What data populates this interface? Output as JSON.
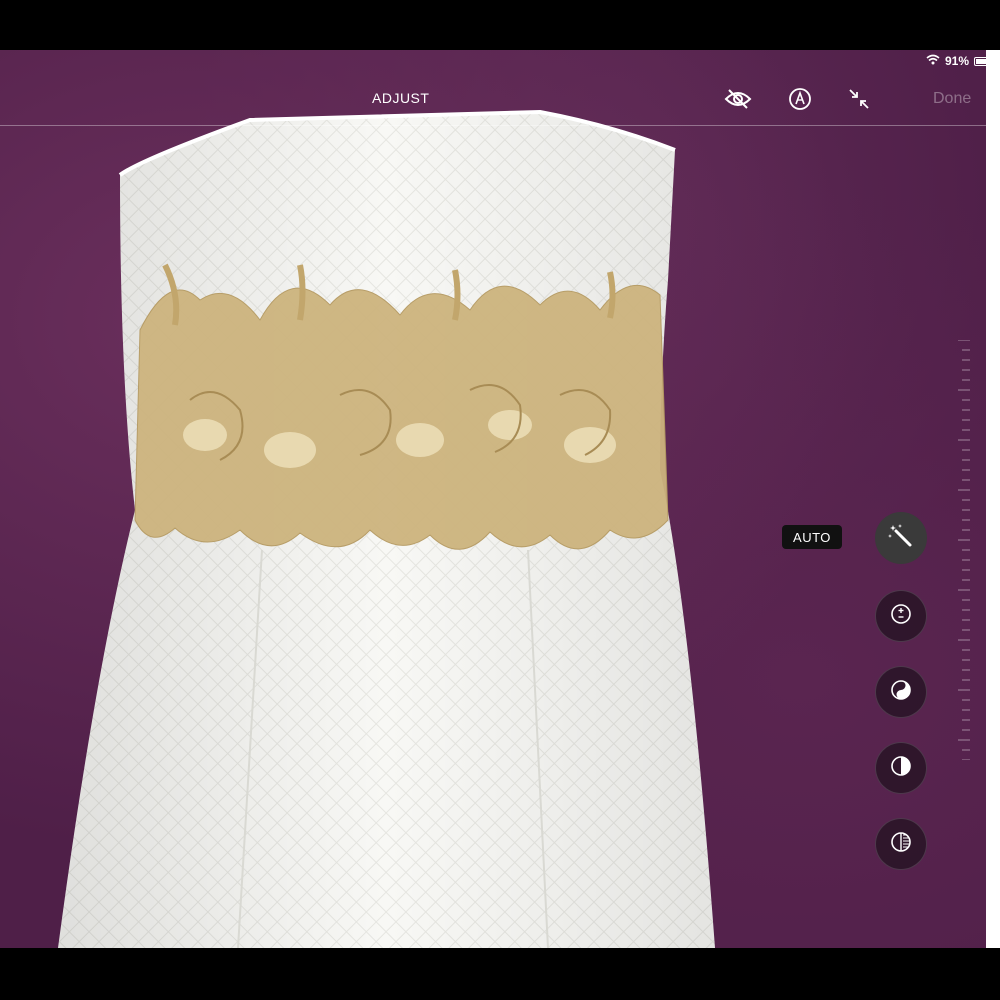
{
  "status_bar": {
    "battery_text": "91%",
    "battery_level": 0.91,
    "wifi_icon": "wifi-icon"
  },
  "toolbar": {
    "title": "ADJUST",
    "icons": [
      "eye-slash-icon",
      "markup-pen-icon",
      "collapse-arrows-icon"
    ],
    "done_label": "Done"
  },
  "side_tools": {
    "auto_label": "AUTO",
    "items": [
      "magic-wand-icon",
      "exposure-icon",
      "brilliance-icon",
      "highlights-icon",
      "shadows-icon"
    ]
  },
  "colors": {
    "background_fabric": "#4f1f48",
    "dress": "#f7f7f4",
    "lace": "#cdb47e",
    "done_disabled": "rgba(255,255,255,0.35)"
  }
}
